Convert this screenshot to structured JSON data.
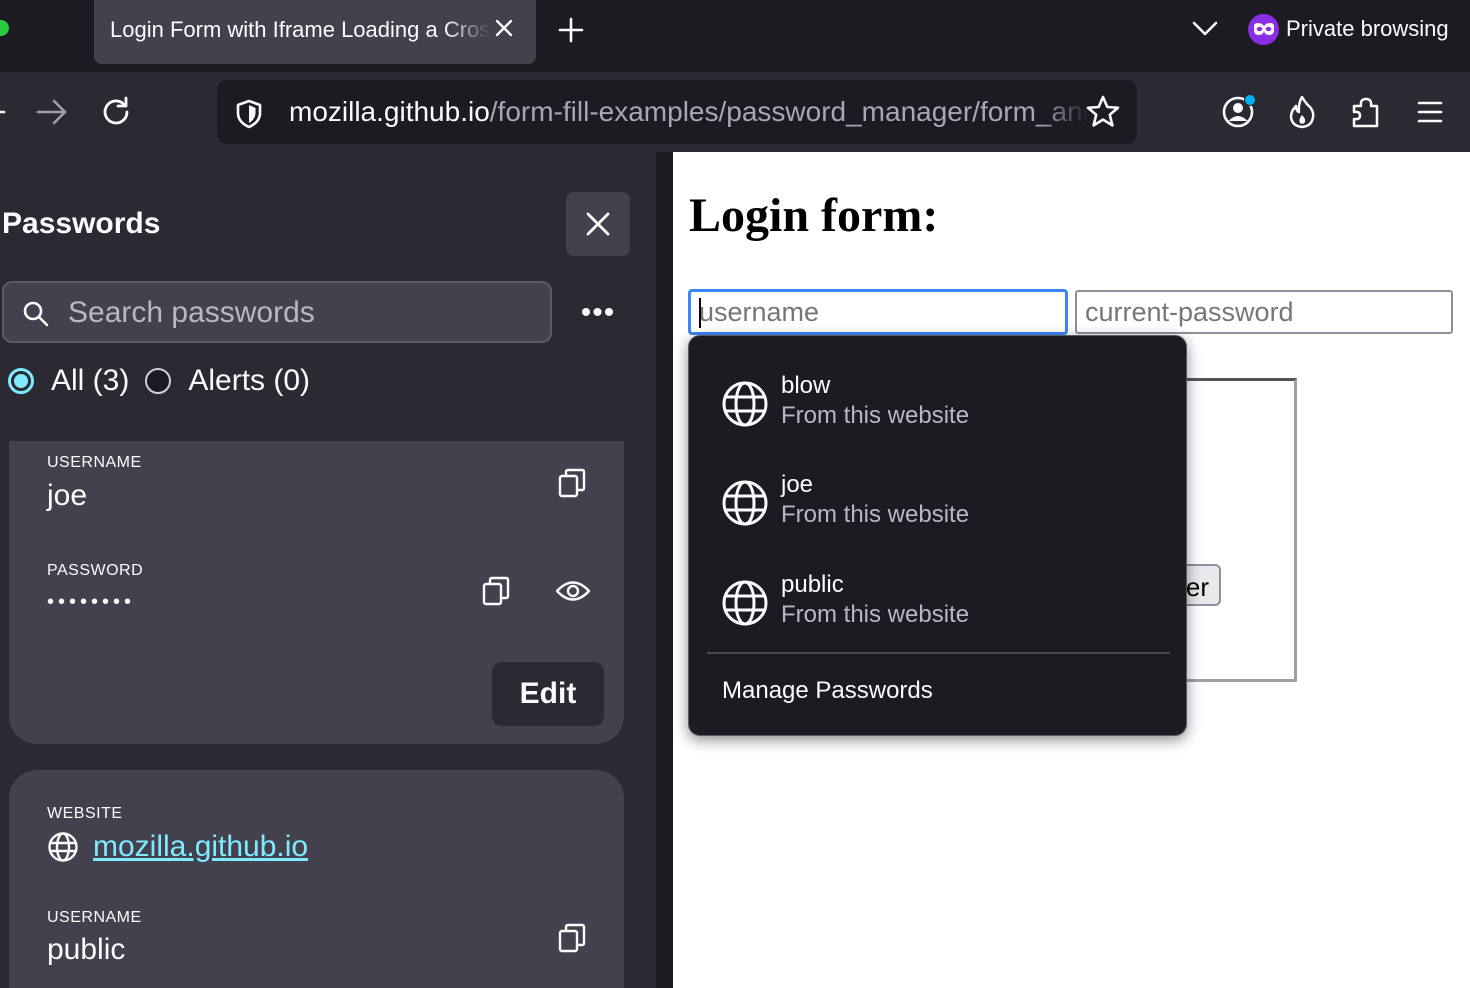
{
  "tabstrip": {
    "active_tab_title": "Login Form with Iframe Loading a Cross-Origin",
    "private_label": "Private browsing"
  },
  "toolbar": {
    "url_host": "mozilla.github.io",
    "url_path": "/form-fill-examples/password_manager/form_and_iframe.html"
  },
  "sidebar": {
    "title": "Passwords",
    "search_placeholder": "Search passwords",
    "more_label": "•••",
    "filters": [
      {
        "label": "All (3)",
        "selected": true
      },
      {
        "label": "Alerts (0)",
        "selected": false
      }
    ],
    "card1": {
      "username_label": "USERNAME",
      "username": "joe",
      "password_label": "PASSWORD",
      "password_mask": "••••••••",
      "edit_label": "Edit"
    },
    "card2": {
      "website_label": "WEBSITE",
      "website": "mozilla.github.io",
      "username_label": "USERNAME",
      "username": "public"
    }
  },
  "page": {
    "heading": "Login form:",
    "username_placeholder": "username",
    "password_placeholder": "current-password",
    "iframe_button_partial": "er"
  },
  "autocomplete": {
    "items": [
      {
        "name": "blow",
        "source": "From this website"
      },
      {
        "name": "joe",
        "source": "From this website"
      },
      {
        "name": "public",
        "source": "From this website"
      }
    ],
    "manage_label": "Manage Passwords"
  },
  "colors": {
    "accent": "#80ebff",
    "focus_ring": "#3b86f7",
    "private_purple": "#8a2ee6"
  }
}
